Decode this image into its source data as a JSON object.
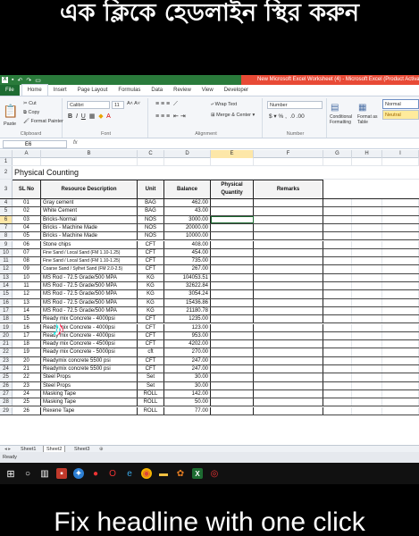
{
  "captions": {
    "top": "এক ক্লিকে হেডলাইন স্থির করুন",
    "bottom": "Fix headline with one click"
  },
  "window": {
    "title": "New Microsoft Excel Worksheet (4) - Microsoft Excel (Product Activation Failed)"
  },
  "menu": [
    "File",
    "Home",
    "Insert",
    "Page Layout",
    "Formulas",
    "Data",
    "Review",
    "View",
    "Developer"
  ],
  "ribbon": {
    "paste": "Paste",
    "cut": "Cut",
    "copy": "Copy",
    "format_painter": "Format Painter",
    "clipboard": "Clipboard",
    "font_name": "Calibri",
    "font_size": "11",
    "font": "Font",
    "wrap_text": "Wrap Text",
    "merge_center": "Merge & Center",
    "alignment": "Alignment",
    "number_format": "Number",
    "number": "Number",
    "conditional": "Conditional Formatting",
    "format_as": "Format as Table",
    "style_normal": "Normal",
    "style_neutral": "Neutral"
  },
  "formula_bar": {
    "name_box": "E6",
    "fx": "fx"
  },
  "columns": [
    "A",
    "B",
    "C",
    "D",
    "E",
    "F",
    "G",
    "H",
    "I"
  ],
  "sheet": {
    "title": "Physical Counting",
    "headers": {
      "sl": "SL No",
      "desc": "Resource Description",
      "unit": "Unit",
      "balance": "Balance",
      "phys": "Physical Quantity",
      "remarks": "Remarks"
    },
    "rows": [
      {
        "r": "4",
        "sl": "01",
        "desc": "Gray cement",
        "unit": "BAG",
        "bal": "462.00"
      },
      {
        "r": "5",
        "sl": "02",
        "desc": "White Cement",
        "unit": "BAG",
        "bal": "43.00"
      },
      {
        "r": "6",
        "sl": "03",
        "desc": "Bricks-Normal",
        "unit": "NOS",
        "bal": "3000.00"
      },
      {
        "r": "7",
        "sl": "04",
        "desc": "Bricks - Machine Made",
        "unit": "NOS",
        "bal": "20000.00"
      },
      {
        "r": "8",
        "sl": "05",
        "desc": "Bricks - Machine Made",
        "unit": "NOS",
        "bal": "10000.00"
      },
      {
        "r": "9",
        "sl": "06",
        "desc": "Stone chips",
        "unit": "CFT",
        "bal": "408.00"
      },
      {
        "r": "10",
        "sl": "07",
        "desc": "Fine Sand / Local Sand (FM 1.10-1.25)",
        "unit": "CFT",
        "bal": "454.00"
      },
      {
        "r": "11",
        "sl": "08",
        "desc": "Fine Sand / Local Sand (FM 1.10-1.25)",
        "unit": "CFT",
        "bal": "735.00"
      },
      {
        "r": "12",
        "sl": "09",
        "desc": "Coarse Sand / Sylhet Sand (FM 2.0-2.5)",
        "unit": "CFT",
        "bal": "267.00"
      },
      {
        "r": "13",
        "sl": "10",
        "desc": "MS Rod - 72.5 Grade/500 MPA",
        "unit": "KG",
        "bal": "104053.51"
      },
      {
        "r": "14",
        "sl": "11",
        "desc": "MS Rod - 72.5 Grade/500 MPA",
        "unit": "KG",
        "bal": "32622.84"
      },
      {
        "r": "15",
        "sl": "12",
        "desc": "MS Rod - 72.5 Grade/500 MPA",
        "unit": "KG",
        "bal": "3054.24"
      },
      {
        "r": "16",
        "sl": "13",
        "desc": "MS Rod - 72.5 Grade/500 MPA",
        "unit": "KG",
        "bal": "15436.86"
      },
      {
        "r": "17",
        "sl": "14",
        "desc": "MS Rod - 72.5 Grade/500 MPA",
        "unit": "KG",
        "bal": "21180.78"
      },
      {
        "r": "18",
        "sl": "15",
        "desc": "Ready mix Concrete - 4000psi",
        "unit": "CFT",
        "bal": "1235.00"
      },
      {
        "r": "19",
        "sl": "16",
        "desc": "Ready mix Concrete - 4000psi",
        "unit": "CFT",
        "bal": "123.00"
      },
      {
        "r": "20",
        "sl": "17",
        "desc": "Ready mix Concrete - 4000psi",
        "unit": "CFT",
        "bal": "953.00"
      },
      {
        "r": "21",
        "sl": "18",
        "desc": "Ready mix Concrete - 4500psi",
        "unit": "CFT",
        "bal": "4202.00"
      },
      {
        "r": "22",
        "sl": "19",
        "desc": "Ready mix Concrete - 5000psi",
        "unit": "cft",
        "bal": "270.00"
      },
      {
        "r": "23",
        "sl": "20",
        "desc": "Readymix concrete 5500 psi",
        "unit": "CFT",
        "bal": "247.00"
      },
      {
        "r": "24",
        "sl": "21",
        "desc": "Readymix concrete 5500 psi",
        "unit": "CFT",
        "bal": "247.00"
      },
      {
        "r": "25",
        "sl": "22",
        "desc": "Steel Props",
        "unit": "Set",
        "bal": "30.00"
      },
      {
        "r": "26",
        "sl": "23",
        "desc": "Steel Props",
        "unit": "Set",
        "bal": "30.00"
      },
      {
        "r": "27",
        "sl": "24",
        "desc": "Masking Tape",
        "unit": "ROLL",
        "bal": "142.00"
      },
      {
        "r": "28",
        "sl": "25",
        "desc": "Masking Tape",
        "unit": "ROLL",
        "bal": "50.00"
      },
      {
        "r": "29",
        "sl": "26",
        "desc": "Rexene Tape",
        "unit": "ROLL",
        "bal": "77.00"
      }
    ]
  },
  "sheet_tabs": [
    "Sheet1",
    "Sheet2",
    "Sheet3"
  ],
  "status": "Ready",
  "colors": {
    "excel_green": "#2a7b3b",
    "title_red": "#e84a36",
    "selection": "#fde7a8"
  },
  "taskbar_icons": [
    "windows-icon",
    "search-icon",
    "task-view-icon",
    "app-icon",
    "safari-icon",
    "record-icon",
    "opera-icon",
    "edge-icon",
    "chrome-icon",
    "folder-icon",
    "photos-icon",
    "excel-icon",
    "recorder-icon"
  ]
}
